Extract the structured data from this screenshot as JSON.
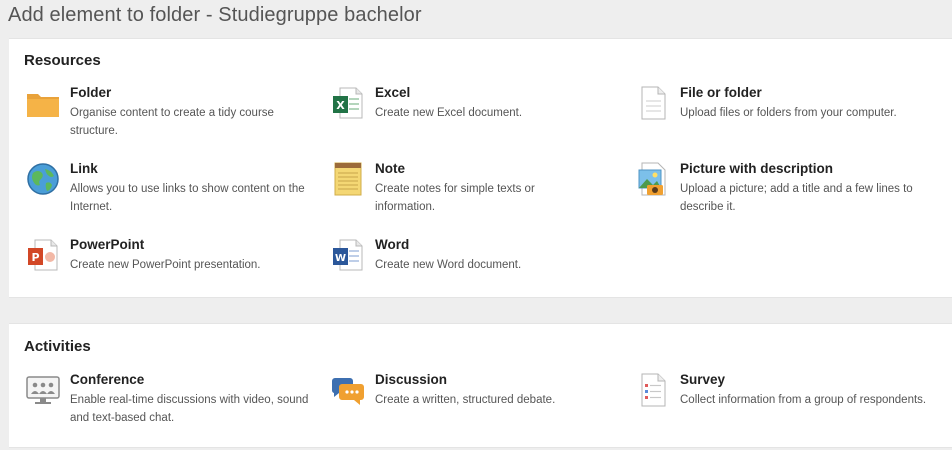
{
  "page": {
    "title": "Add element to folder - Studiegruppe bachelor"
  },
  "resources": {
    "title": "Resources",
    "items": [
      {
        "name": "Folder",
        "desc": "Organise content to create a tidy course structure.",
        "icon": "folder-icon"
      },
      {
        "name": "Excel",
        "desc": "Create new Excel document.",
        "icon": "excel-icon"
      },
      {
        "name": "File or folder",
        "desc": "Upload files or folders from your computer.",
        "icon": "file-icon"
      },
      {
        "name": "Link",
        "desc": "Allows you to use links to show content on the Internet.",
        "icon": "globe-icon"
      },
      {
        "name": "Note",
        "desc": "Create notes for simple texts or information.",
        "icon": "notepad-icon"
      },
      {
        "name": "Picture with description",
        "desc": "Upload a picture; add a title and a few lines to describe it.",
        "icon": "picture-icon"
      },
      {
        "name": "PowerPoint",
        "desc": "Create new PowerPoint presentation.",
        "icon": "powerpoint-icon"
      },
      {
        "name": "Word",
        "desc": "Create new Word document.",
        "icon": "word-icon"
      }
    ]
  },
  "activities": {
    "title": "Activities",
    "items": [
      {
        "name": "Conference",
        "desc": "Enable real-time discussions with video, sound and text-based chat.",
        "icon": "conference-icon"
      },
      {
        "name": "Discussion",
        "desc": "Create a written, structured debate.",
        "icon": "discussion-icon"
      },
      {
        "name": "Survey",
        "desc": "Collect information from a group of respondents.",
        "icon": "survey-icon"
      }
    ]
  },
  "colors": {
    "folder": "#f5b347",
    "excel": "#217346",
    "powerpoint": "#d24726",
    "word": "#2b579a",
    "note": "#f4d774",
    "discussion_orange": "#f0a030",
    "discussion_blue": "#3d6fb0"
  }
}
